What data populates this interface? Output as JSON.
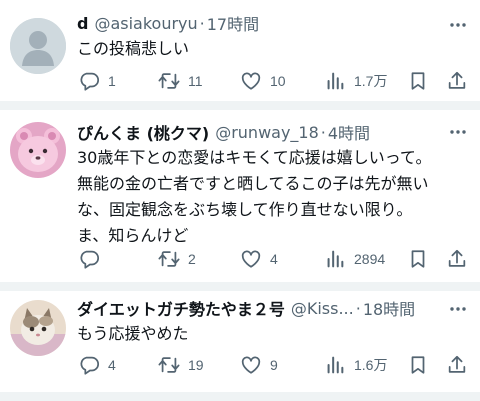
{
  "tweets": [
    {
      "name": "d",
      "handle": "@asiakouryu",
      "time": "17時間",
      "text_lines": [
        "この投稿悲しい"
      ],
      "reply_count": "1",
      "retweet_count": "11",
      "like_count": "10",
      "view_count": "1.7万"
    },
    {
      "name": "ぴんくま (桃クマ)",
      "handle": "@runway_18",
      "time": "4時間",
      "text_lines": [
        "30歳年下との恋愛はキモくて応援は嬉しいって。",
        "無能の金の亡者ですと晒してるこの子は先が無い",
        "な、固定観念をぶち壊して作り直せない限り。",
        "ま、知らんけど"
      ],
      "reply_count": "",
      "retweet_count": "2",
      "like_count": "4",
      "view_count": "2894"
    },
    {
      "name": "ダイエットガチ勢たやま２号",
      "handle": "@Kiss...",
      "time": "18時間",
      "text_lines": [
        "もう応援やめた"
      ],
      "reply_count": "4",
      "retweet_count": "19",
      "like_count": "9",
      "view_count": "1.6万"
    }
  ],
  "separator_dot": "·",
  "icons": [
    "avatar-default",
    "more-icon",
    "reply-icon",
    "retweet-icon",
    "like-icon",
    "views-icon",
    "bookmark-icon",
    "share-icon"
  ],
  "colors": {
    "text": "#0f1419",
    "secondary": "#536471",
    "separator": "#eff3f4"
  }
}
